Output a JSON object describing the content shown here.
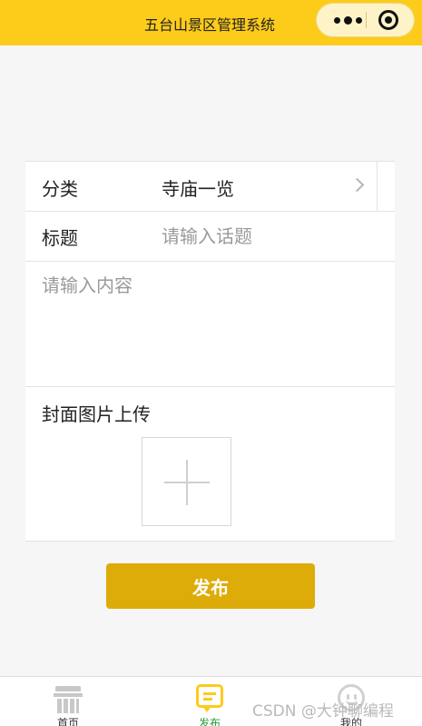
{
  "navbar": {
    "title": "五台山景区管理系统"
  },
  "form": {
    "category_label": "分类",
    "category_value": "寺庙一览",
    "title_label": "标题",
    "title_placeholder": "请输入话题",
    "title_value": "",
    "content_placeholder": "请输入内容",
    "content_value": "",
    "cover_label": "封面图片上传"
  },
  "actions": {
    "publish_label": "发布"
  },
  "tabbar": {
    "items": [
      {
        "label": "首页",
        "icon": "temple-icon",
        "active": false
      },
      {
        "label": "发布",
        "icon": "chat-icon",
        "active": true
      },
      {
        "label": "我的",
        "icon": "smile-icon",
        "active": false
      }
    ]
  },
  "watermark": "CSDN @大钟聊编程",
  "colors": {
    "navbar": "#fdcb1a",
    "publish_button": "#ddac08",
    "active_tab": "#22a03a"
  }
}
